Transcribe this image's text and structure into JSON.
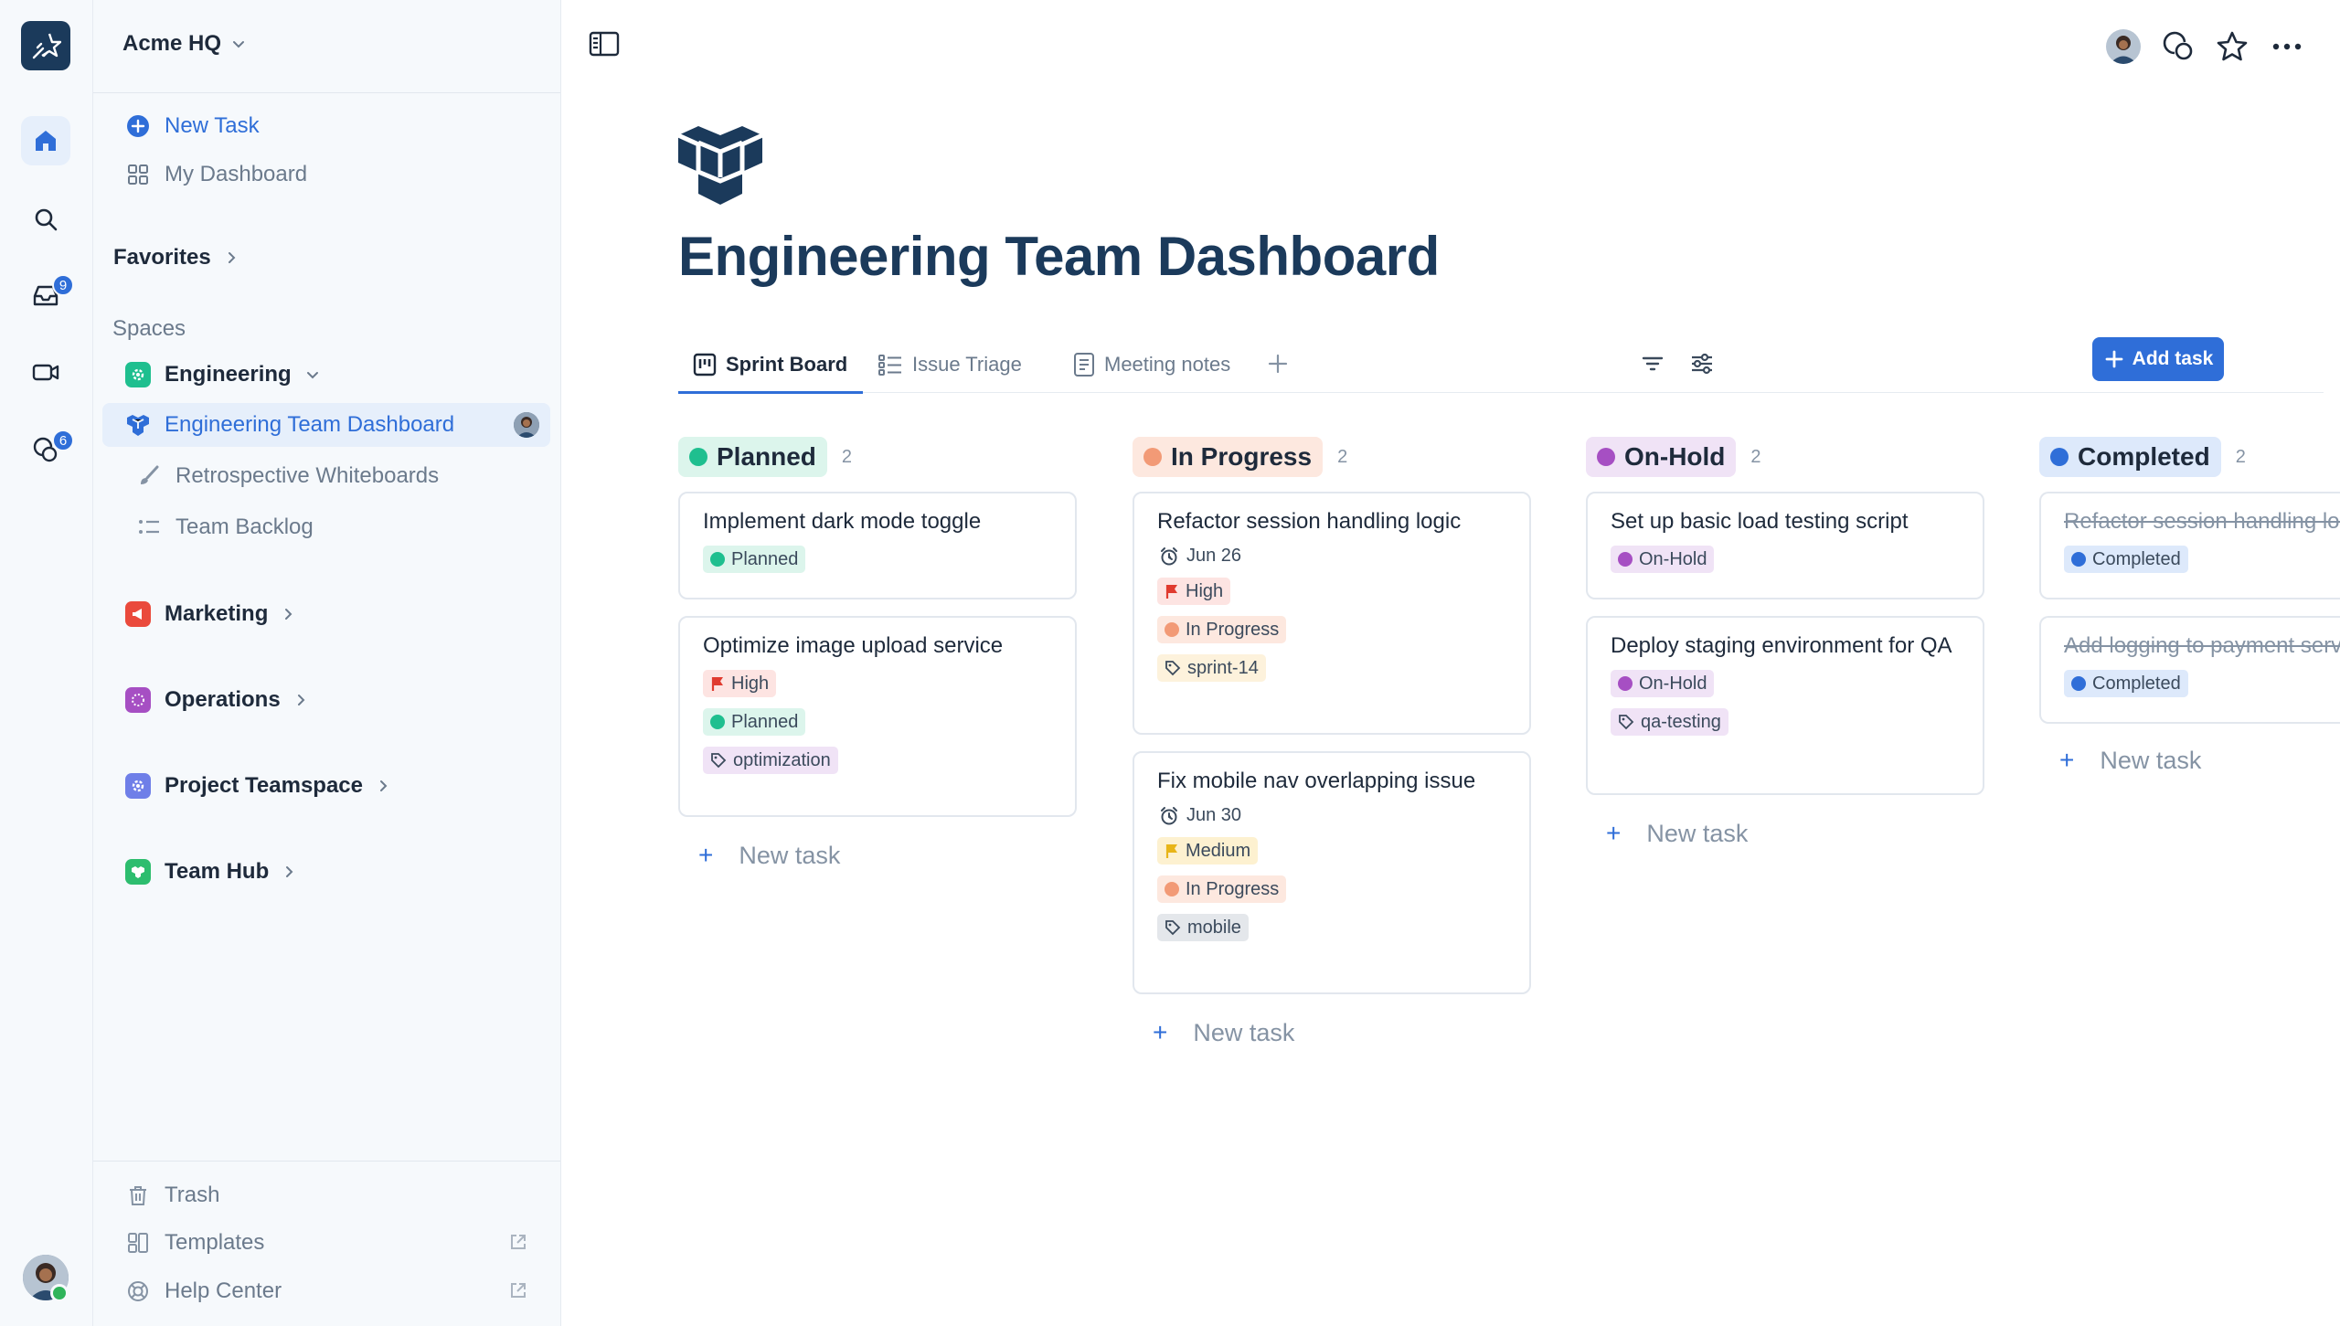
{
  "workspace": {
    "name": "Acme HQ"
  },
  "rail": {
    "inbox_badge": "9",
    "chat_badge": "6"
  },
  "sidebar": {
    "new_task": "New Task",
    "my_dashboard": "My Dashboard",
    "favorites": "Favorites",
    "spaces_label": "Spaces",
    "engineering": {
      "label": "Engineering",
      "children": [
        "Engineering Team Dashboard",
        "Retrospective Whiteboards",
        "Team Backlog"
      ]
    },
    "spaces": [
      "Marketing",
      "Operations",
      "Project Teamspace",
      "Team Hub"
    ],
    "bottom": [
      "Trash",
      "Templates",
      "Help Center"
    ]
  },
  "page": {
    "title": "Engineering Team Dashboard",
    "tabs": [
      "Sprint Board",
      "Issue Triage",
      "Meeting notes"
    ],
    "add_task": "Add task"
  },
  "colors": {
    "accent": "#2f6ed8",
    "planned": "#1fbf8f",
    "in_progress": "#f29a76",
    "on_hold": "#a64fc3",
    "completed": "#2f6ed8"
  },
  "board": {
    "new_task_label": "New task",
    "columns": [
      {
        "name": "Planned",
        "count": "2",
        "cards": [
          {
            "title": "Implement dark mode toggle",
            "tags": [
              "Planned"
            ]
          },
          {
            "title": "Optimize image upload service",
            "tags": [
              "High",
              "Planned",
              "optimization"
            ]
          }
        ]
      },
      {
        "name": "In Progress",
        "count": "2",
        "cards": [
          {
            "title": "Refactor session handling logic",
            "due": "Jun 26",
            "tags": [
              "High",
              "In Progress",
              "sprint-14"
            ]
          },
          {
            "title": "Fix mobile nav overlapping issue",
            "due": "Jun 30",
            "tags": [
              "Medium",
              "In Progress",
              "mobile"
            ]
          }
        ]
      },
      {
        "name": "On-Hold",
        "count": "2",
        "cards": [
          {
            "title": "Set up basic load testing script",
            "tags": [
              "On-Hold"
            ]
          },
          {
            "title": "Deploy staging environment for QA",
            "tags": [
              "On-Hold",
              "qa-testing"
            ]
          }
        ]
      },
      {
        "name": "Completed",
        "count": "2",
        "cards": [
          {
            "title": "Refactor session handling logic",
            "tags": [
              "Completed"
            ]
          },
          {
            "title": "Add logging to payment service",
            "tags": [
              "Completed"
            ]
          }
        ]
      }
    ]
  }
}
